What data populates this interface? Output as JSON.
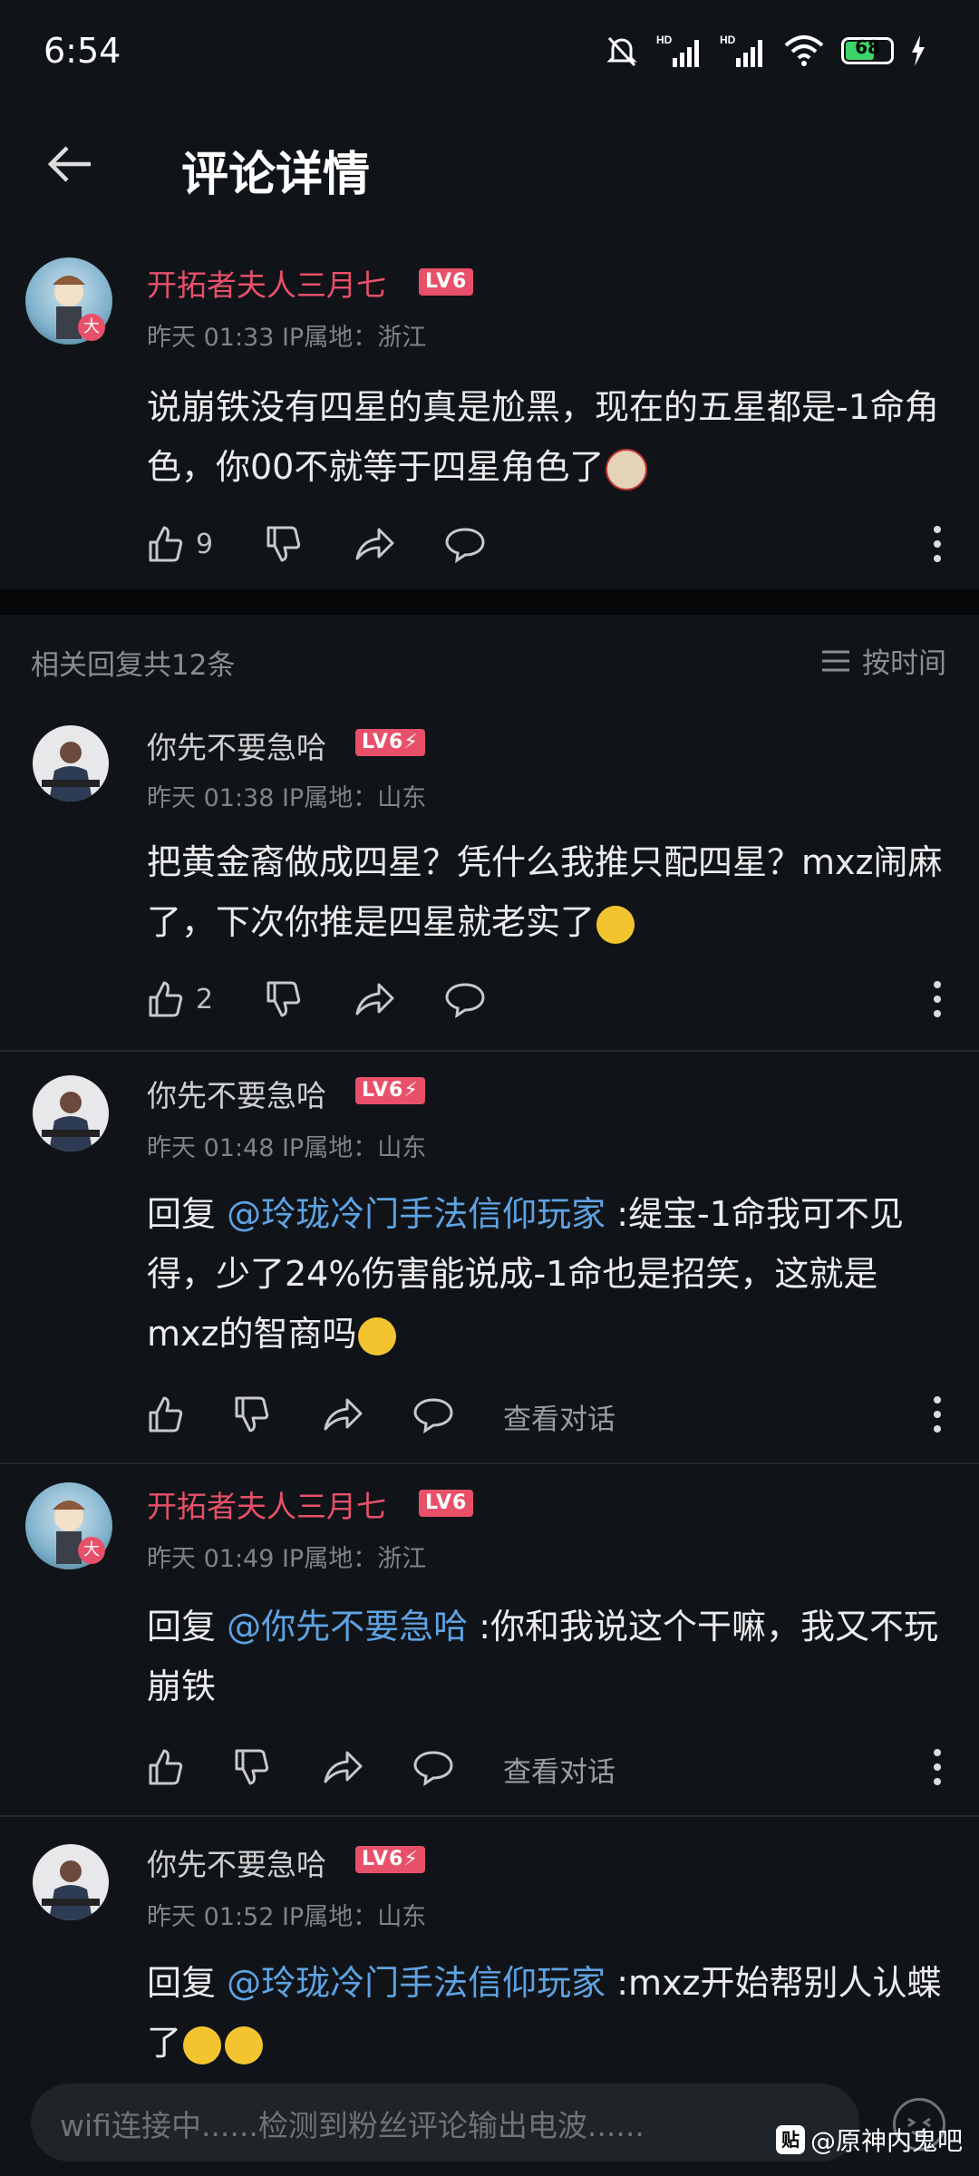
{
  "status": {
    "time": "6:54",
    "battery": "68",
    "battery_level": 0.68
  },
  "header": {
    "title": "评论详情"
  },
  "main_comment": {
    "username": "开拓者夫人三月七",
    "level": "LV6",
    "avatar_badge": "大",
    "meta": "昨天 01:33 IP属地：浙江",
    "content": "说崩铁没有四星的真是尬黑，现在的五星都是-1命角色，你00不就等于四星角色了",
    "likes": "9"
  },
  "replies_bar": {
    "count_label": "相关回复共12条",
    "sort_label": "按时间"
  },
  "replies": [
    {
      "username": "你先不要急哈",
      "level": "LV6⚡",
      "meta": "昨天 01:38 IP属地：山东",
      "content": "把黄金裔做成四星？凭什么我推只配四星？mxz闹麻了，下次你推是四星就老实了",
      "likes": "2"
    },
    {
      "username": "你先不要急哈",
      "level": "LV6⚡",
      "meta": "昨天 01:48 IP属地：山东",
      "reply_prefix": "回复 ",
      "mention": "@玲珑冷门手法信仰玩家",
      "content": " :缇宝-1命我可不见得，少了24%伤害能说成-1命也是招笑，这就是mxz的智商吗",
      "view_convo": "查看对话"
    },
    {
      "username": "开拓者夫人三月七",
      "level": "LV6",
      "avatar_badge": "大",
      "meta": "昨天 01:49 IP属地：浙江",
      "reply_prefix": "回复 ",
      "mention": "@你先不要急哈",
      "content": " :你和我说这个干嘛，我又不玩崩铁",
      "view_convo": "查看对话"
    },
    {
      "username": "你先不要急哈",
      "level": "LV6⚡",
      "meta": "昨天 01:52 IP属地：山东",
      "reply_prefix": "回复 ",
      "mention": "@玲珑冷门手法信仰玩家",
      "content": " :mxz开始帮别人认蝶了"
    }
  ],
  "input": {
    "placeholder": "wifi连接中......检测到粉丝评论输出电波......"
  },
  "watermark": {
    "badge": "贴",
    "text": "@原神内鬼吧"
  },
  "colors": {
    "background": "#101418",
    "accent_pink": "#e8506a",
    "mention_blue": "#5fa3e3"
  }
}
